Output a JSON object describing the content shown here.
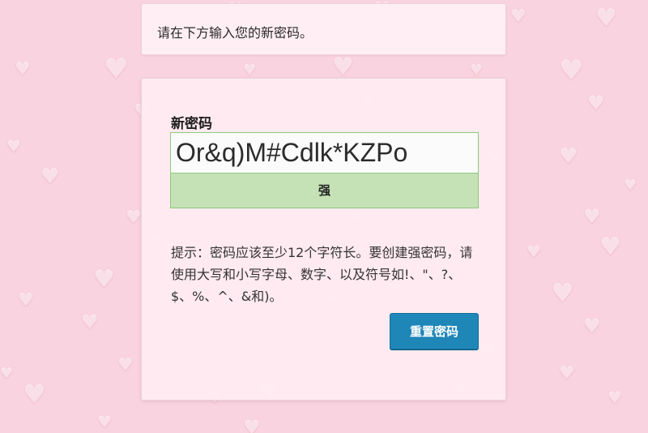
{
  "notice": {
    "text": "请在下方输入您的新密码。"
  },
  "form": {
    "label": "新密码",
    "password_value": "Or&q)M#Cdlk*KZPo",
    "strength_label": "强",
    "strength_color": "#c5e2b6",
    "hint": "提示：密码应该至少12个字符长。要创建强密码，请使用大写和小写字母、数字、以及符号如!、\"、?、$、%、^、&和)。",
    "submit_label": "重置密码",
    "submit_color": "#1f86b8"
  },
  "background": {
    "color": "#f9d3df",
    "pattern": "heart-icon"
  }
}
